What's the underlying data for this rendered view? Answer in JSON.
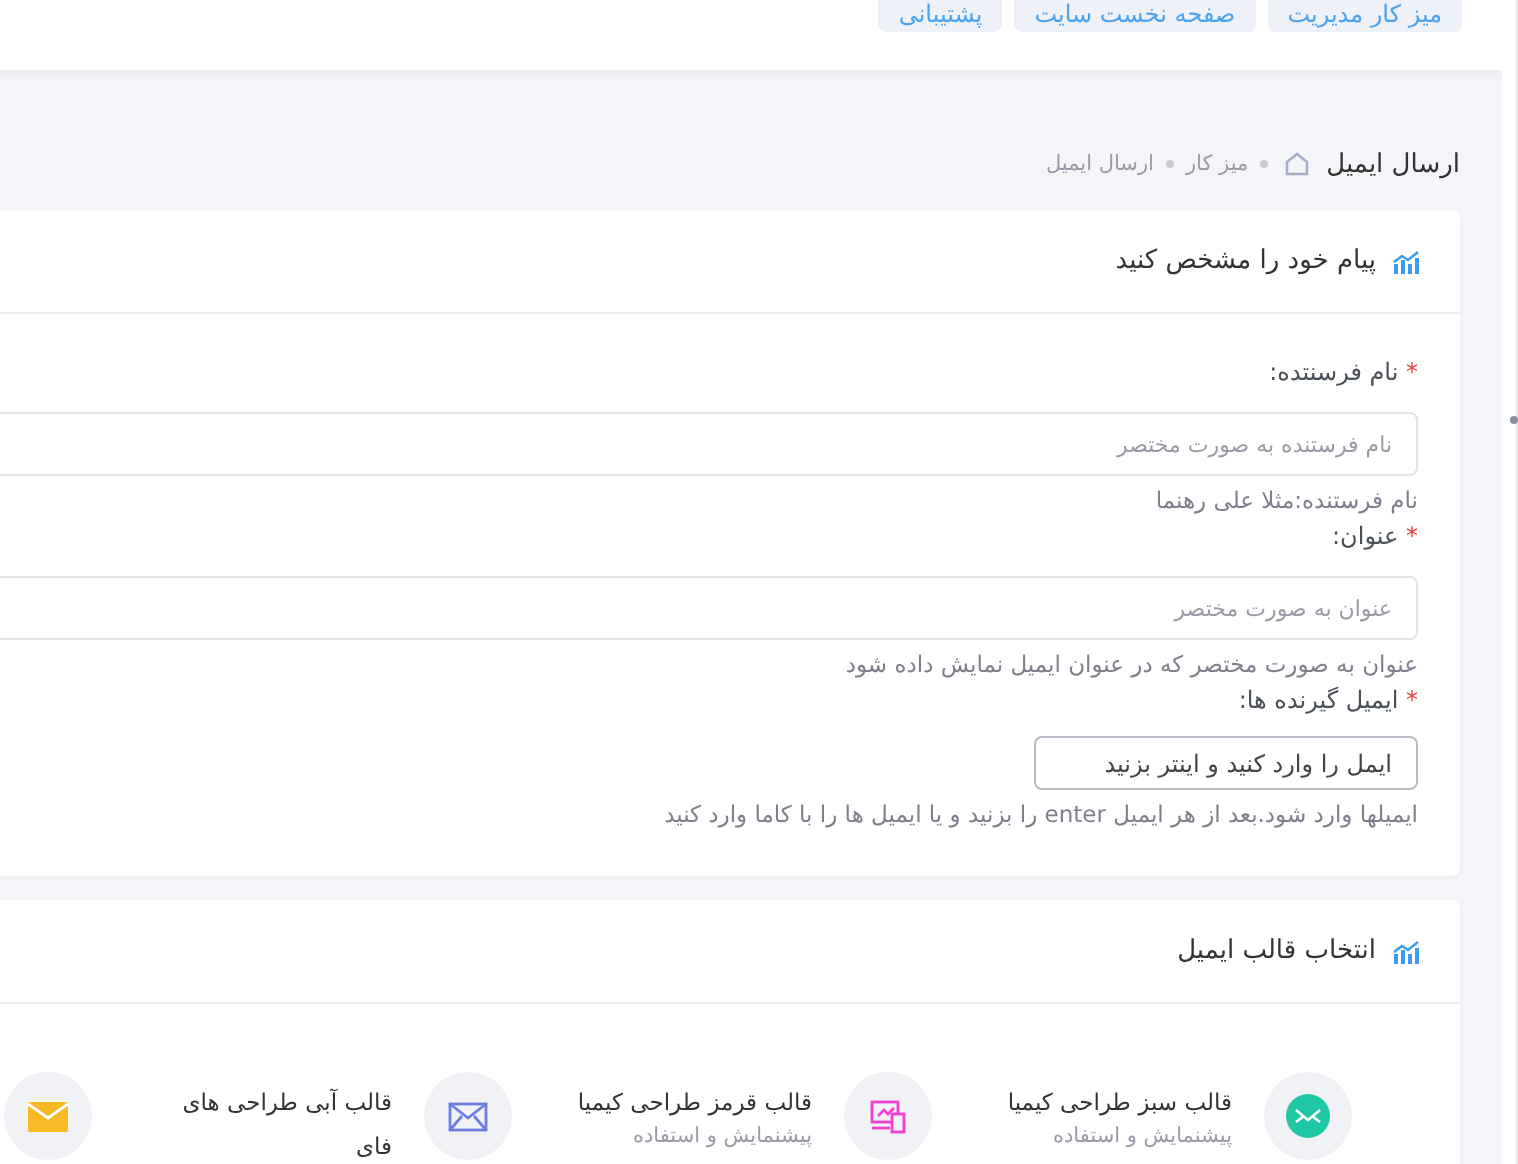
{
  "top_buttons": [
    {
      "label": "میز کار مدیریت"
    },
    {
      "label": "صفحه نخست سایت"
    },
    {
      "label": "پشتیبانی"
    }
  ],
  "breadcrumb": {
    "title": "ارسال ایمیل",
    "items": [
      "میز کار",
      "ارسال ایمیل"
    ]
  },
  "message_card": {
    "title": "پیام خود را مشخص کنید",
    "fields": [
      {
        "label": "نام فرسنتده:",
        "required_mark": "*",
        "placeholder": "نام فرستنده به صورت مختصر",
        "help": "نام فرستنده:مثلا علی رهنما",
        "kind": "text"
      },
      {
        "label": "عنوان:",
        "required_mark": "*",
        "placeholder": "عنوان به صورت مختصر",
        "help": "عنوان به صورت مختصر که در عنوان ایمیل نمایش داده شود",
        "kind": "text"
      },
      {
        "label": "ایمیل گیرنده ها:",
        "required_mark": "*",
        "placeholder": "ایمل را وارد کنید و اینتر بزنید",
        "help": "ایمیلها وارد شود.بعد از هر ایمیل enter را بزنید و یا ایمیل ها را با کاما وارد کنید",
        "kind": "tags"
      }
    ]
  },
  "template_card": {
    "title": "انتخاب قالب ایمیل",
    "templates": [
      {
        "title": "قالب سبز طراحی کیمیا",
        "subtitle": "پیشنمایش و استفاده",
        "kind": "envelope-disc",
        "color": "#1ec8a5"
      },
      {
        "title": "قالب قرمز طراحی کیمیا",
        "subtitle": "پیشنمایش و استفاده",
        "kind": "devices",
        "color": "#f03fd2"
      },
      {
        "title": "قالب آبی طراحی های فای",
        "kind": "envelope",
        "color": "#6c7ee1"
      },
      {
        "kind": "envelope-filled",
        "color": "#f7b924"
      }
    ]
  }
}
